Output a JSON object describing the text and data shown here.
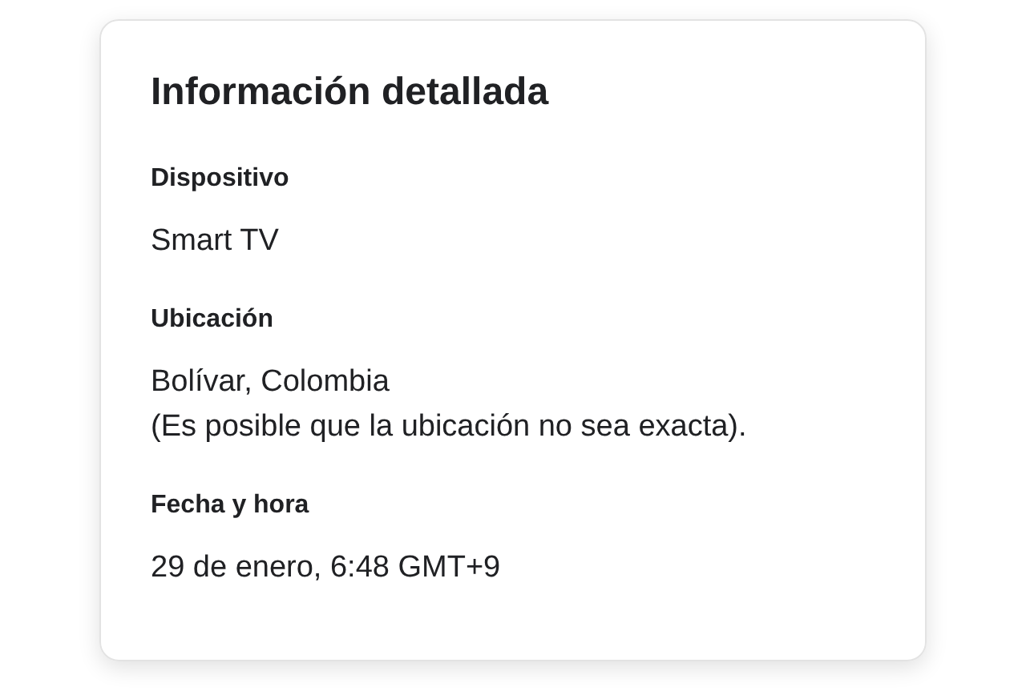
{
  "card": {
    "title": "Información detallada",
    "sections": [
      {
        "label": "Dispositivo",
        "lines": [
          "Smart TV"
        ]
      },
      {
        "label": "Ubicación",
        "lines": [
          "Bolívar, Colombia",
          "(Es posible que la ubicación no sea exacta)."
        ]
      },
      {
        "label": "Fecha y hora",
        "lines": [
          "29 de enero, 6:48 GMT+9"
        ]
      }
    ]
  }
}
